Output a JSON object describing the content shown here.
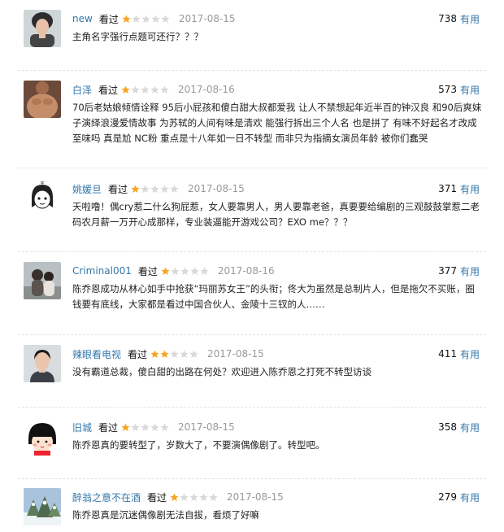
{
  "colors": {
    "link": "#3377aa",
    "star_on": "#f6a623",
    "star_off": "#d9d9d9",
    "date": "#9a9a9a"
  },
  "reviews": [
    {
      "user": "new",
      "status": "看过",
      "rating": 1,
      "max_rating": 5,
      "date": "2017-08-15",
      "votes": "738",
      "vote_label": "有用",
      "text": "主角名字强行点题可还行？？？",
      "avatar_icon": "woman-portrait-icon"
    },
    {
      "user": "白泽",
      "status": "看过",
      "rating": 1,
      "max_rating": 5,
      "date": "2017-08-16",
      "votes": "573",
      "vote_label": "有用",
      "text": "70后老姑娘倾情诠释 95后小屁孩和傻白甜大叔都爱我 让人不禁想起年近半百的钟汉良 和90后爽妹子演绎浪漫爱情故事 为苏轼的人间有味是清欢 能强行拆出三个人名 也是拼了 有味不好起名才改成至味吗 真是尬 NC粉 重点是十八年如一日不转型 而非只为指摘女演员年龄 被你们蠢哭",
      "avatar_icon": "shirtless-man-icon"
    },
    {
      "user": "姚媛旦",
      "status": "看过",
      "rating": 1,
      "max_rating": 5,
      "date": "2017-08-15",
      "votes": "371",
      "vote_label": "有用",
      "text": "天啦噜！偶cry惹二什么狗屁惹，女人要靠男人，男人要靠老爸，真要要给编剧的三观鼓鼓掌惹二老码农月薪一万开心成那样，专业装逼能开游戏公司？EXO me？？？",
      "avatar_icon": "cartoon-girl-icon"
    },
    {
      "user": "Criminal001",
      "status": "看过",
      "rating": 1,
      "max_rating": 5,
      "date": "2017-08-16",
      "votes": "377",
      "vote_label": "有用",
      "text": "陈乔恩成功从林心如手中抢获“玛丽苏女王”的头衔；佟大为虽然是总制片人，但是拖欠不买账，圈钱要有底线，大家都是看过中国合伙人、金陵十三钗的人……",
      "avatar_icon": "couple-photo-icon"
    },
    {
      "user": "辣眼看电视",
      "status": "看过",
      "rating": 2,
      "max_rating": 5,
      "date": "2017-08-15",
      "votes": "411",
      "vote_label": "有用",
      "text": "没有霸道总裁，傻白甜的出路在何处？欢迎进入陈乔恩之打死不转型访谈",
      "avatar_icon": "man-portrait-icon"
    },
    {
      "user": "旧城",
      "status": "看过",
      "rating": 1,
      "max_rating": 5,
      "date": "2017-08-15",
      "votes": "358",
      "vote_label": "有用",
      "text": "陈乔恩真的要转型了，岁数大了，不要演偶像剧了。转型吧。",
      "avatar_icon": "cartoon-maruko-icon"
    },
    {
      "user": "醉翁之意不在酒",
      "status": "看过",
      "rating": 1,
      "max_rating": 5,
      "date": "2017-08-15",
      "votes": "279",
      "vote_label": "有用",
      "text": "陈乔恩真是沉迷偶像剧无法自拔，看烦了好嘛",
      "avatar_icon": "snowy-trees-icon"
    }
  ]
}
